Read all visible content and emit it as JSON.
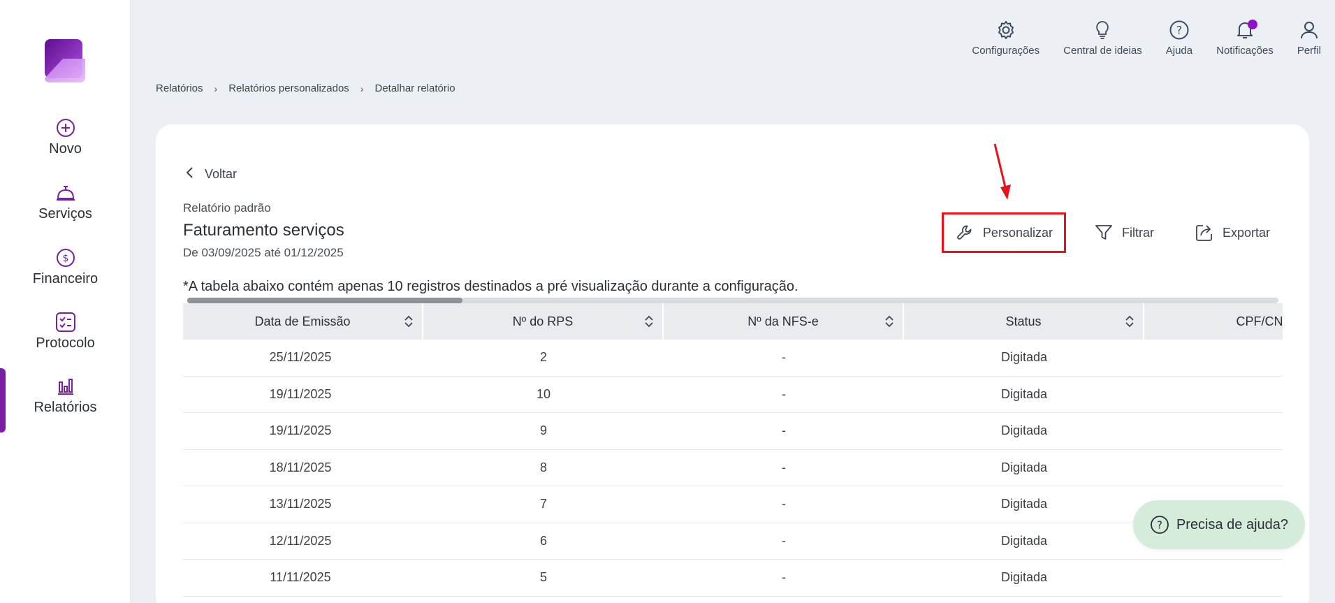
{
  "colors": {
    "brand": "#7b1fa2",
    "highlight": "#e3131b",
    "help_bg": "#d4ecd9"
  },
  "sidebar": {
    "items": [
      {
        "label": "Novo",
        "icon": "plus-circle-icon"
      },
      {
        "label": "Serviços",
        "icon": "service-bell-icon"
      },
      {
        "label": "Financeiro",
        "icon": "dollar-circle-icon"
      },
      {
        "label": "Protocolo",
        "icon": "checklist-icon"
      },
      {
        "label": "Relatórios",
        "icon": "bar-chart-icon"
      }
    ],
    "active": "Relatórios"
  },
  "topbar": {
    "items": [
      {
        "label": "Configurações",
        "icon": "gear-icon"
      },
      {
        "label": "Central de ideias",
        "icon": "lightbulb-icon"
      },
      {
        "label": "Ajuda",
        "icon": "question-circle-icon"
      },
      {
        "label": "Notificações",
        "icon": "bell-icon"
      },
      {
        "label": "Perfil",
        "icon": "user-icon"
      }
    ]
  },
  "breadcrumb": [
    "Relatórios",
    "Relatórios personalizados",
    "Detalhar relatório"
  ],
  "back_label": "Voltar",
  "report": {
    "subtitle": "Relatório padrão",
    "title": "Faturamento serviços",
    "range": "De 03/09/2025 até 01/12/2025"
  },
  "actions": {
    "customize": "Personalizar",
    "filter": "Filtrar",
    "export": "Exportar"
  },
  "note": "*A tabela abaixo contém apenas 10 registros destinados a pré visualização durante a configuração.",
  "table": {
    "columns": [
      "Data de Emissão",
      "Nº do RPS",
      "Nº da NFS-e",
      "Status",
      "CPF/CNP"
    ],
    "rows": [
      [
        "25/11/2025",
        "2",
        "-",
        "Digitada",
        ""
      ],
      [
        "19/11/2025",
        "10",
        "-",
        "Digitada",
        ""
      ],
      [
        "19/11/2025",
        "9",
        "-",
        "Digitada",
        ""
      ],
      [
        "18/11/2025",
        "8",
        "-",
        "Digitada",
        ""
      ],
      [
        "13/11/2025",
        "7",
        "-",
        "Digitada",
        ""
      ],
      [
        "12/11/2025",
        "6",
        "-",
        "Digitada",
        ""
      ],
      [
        "11/11/2025",
        "5",
        "-",
        "Digitada",
        ""
      ]
    ]
  },
  "help_label": "Precisa de ajuda?"
}
